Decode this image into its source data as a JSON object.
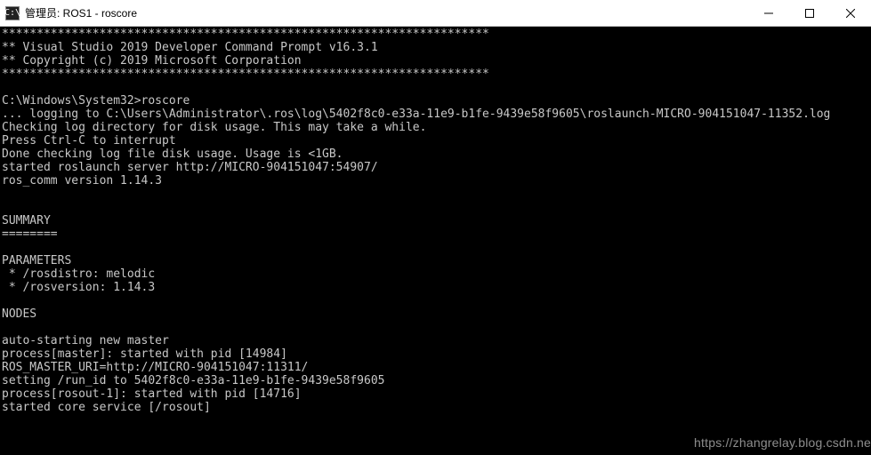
{
  "window": {
    "icon_label": "C:\\",
    "title": "管理员: ROS1 - roscore"
  },
  "terminal": {
    "lines": [
      "**********************************************************************",
      "** Visual Studio 2019 Developer Command Prompt v16.3.1",
      "** Copyright (c) 2019 Microsoft Corporation",
      "**********************************************************************",
      "",
      "C:\\Windows\\System32>roscore",
      "... logging to C:\\Users\\Administrator\\.ros\\log\\5402f8c0-e33a-11e9-b1fe-9439e58f9605\\roslaunch-MICRO-904151047-11352.log",
      "Checking log directory for disk usage. This may take a while.",
      "Press Ctrl-C to interrupt",
      "Done checking log file disk usage. Usage is <1GB.",
      "started roslaunch server http://MICRO-904151047:54907/",
      "ros_comm version 1.14.3",
      "",
      "",
      "SUMMARY",
      "========",
      "",
      "PARAMETERS",
      " * /rosdistro: melodic",
      " * /rosversion: 1.14.3",
      "",
      "NODES",
      "",
      "auto-starting new master",
      "process[master]: started with pid [14984]",
      "ROS_MASTER_URI=http://MICRO-904151047:11311/",
      "setting /run_id to 5402f8c0-e33a-11e9-b1fe-9439e58f9605",
      "process[rosout-1]: started with pid [14716]",
      "started core service [/rosout]"
    ]
  },
  "watermark": "https://zhangrelay.blog.csdn.ne"
}
